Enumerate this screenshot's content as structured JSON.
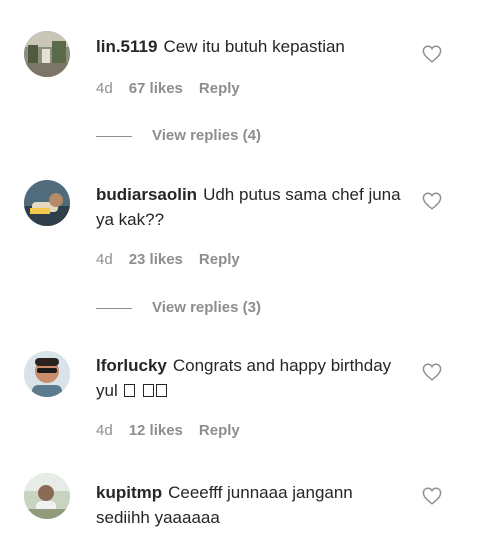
{
  "colors": {
    "text": "#262626",
    "muted": "#8e8e8e",
    "heart_outline": "#8e8e8e"
  },
  "comments": [
    {
      "username": "lin.5119",
      "text": "Cew itu butuh kepastian",
      "time": "4d",
      "likes": "67 likes",
      "reply": "Reply",
      "view_replies": "View replies (4)",
      "avatar_icon": "avatar-photo-landscape"
    },
    {
      "username": "budiarsaolin",
      "text": "Udh putus sama chef juna ya kak??",
      "time": "4d",
      "likes": "23 likes",
      "reply": "Reply",
      "view_replies": "View replies (3)",
      "avatar_icon": "avatar-photo-person-reclining"
    },
    {
      "username": "lforlucky",
      "text": "Congrats and happy birthday yul",
      "emoji_glyphs": "□ □□",
      "time": "4d",
      "likes": "12 likes",
      "reply": "Reply",
      "avatar_icon": "avatar-photo-man-sunglasses"
    },
    {
      "username": "kupitmp",
      "text": "Ceeefff junnaaa jangann sediihh yaaaaaa",
      "avatar_icon": "avatar-photo-person-outdoor"
    }
  ]
}
